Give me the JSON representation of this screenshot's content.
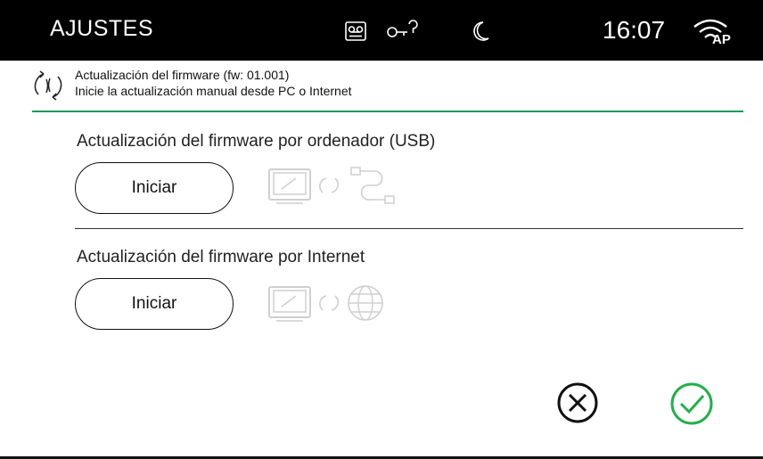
{
  "header": {
    "title": "AJUSTES",
    "time": "16:07",
    "wifi_label": "AP",
    "icons": [
      "voicemail-icon",
      "key-icon",
      "moon-icon",
      "wifi-ap-icon"
    ]
  },
  "info": {
    "line1": "Actualización del firmware (fw: 01.001)",
    "line2": "Inicie la actualización manual desde PC o Internet"
  },
  "sections": {
    "usb": {
      "title": "Actualización del firmware por ordenador (USB)",
      "button_label": "Iniciar"
    },
    "internet": {
      "title": "Actualización del firmware por Internet",
      "button_label": "Iniciar"
    }
  },
  "colors": {
    "accent_green": "#1a9a5a",
    "ok_green": "#22b04a",
    "header_bg": "#000000",
    "faded_icon": "#d0d0d0"
  }
}
